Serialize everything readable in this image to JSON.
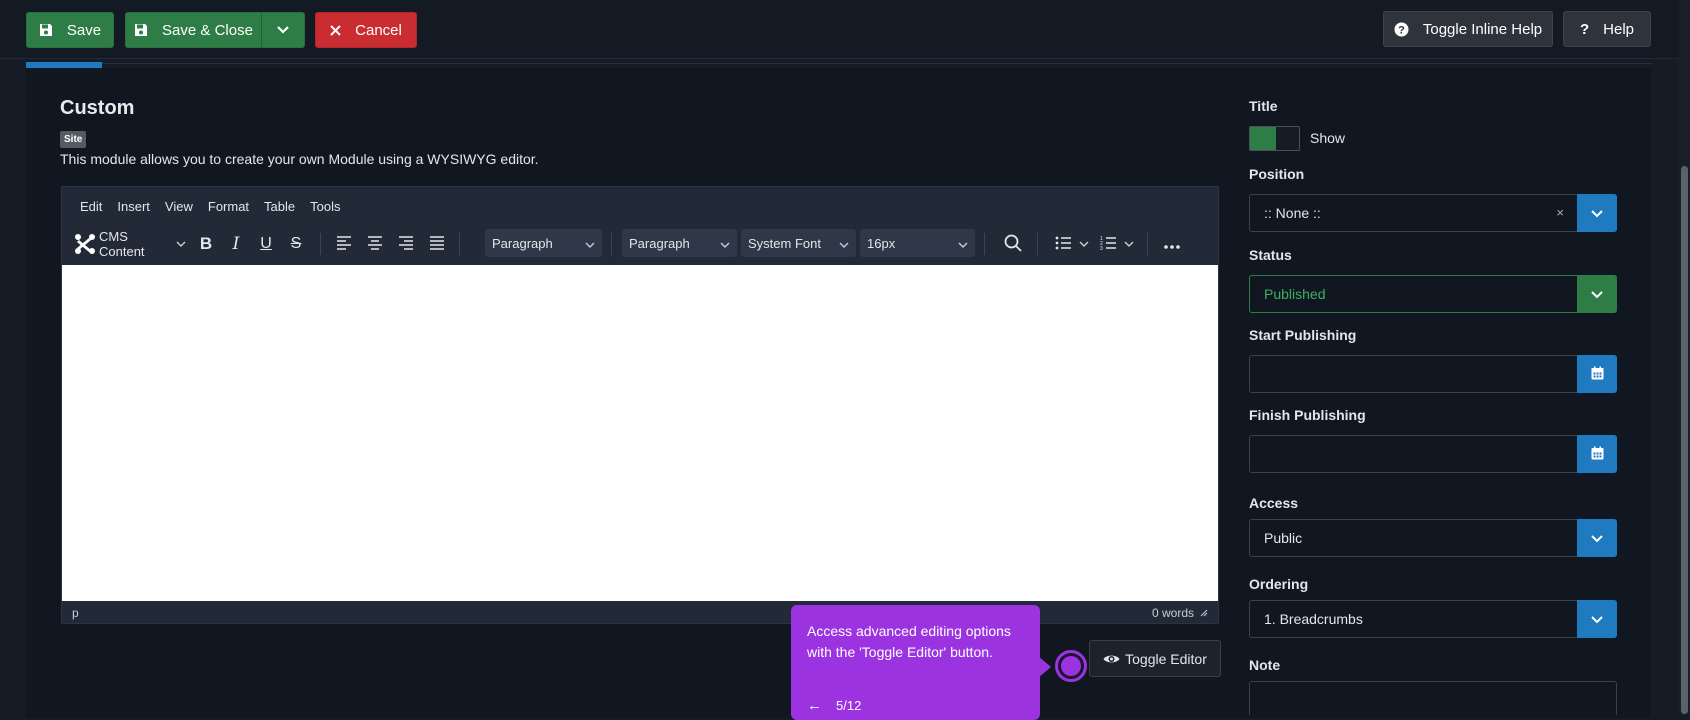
{
  "toolbar": {
    "save_label": "Save",
    "save_close_label": "Save & Close",
    "cancel_label": "Cancel",
    "toggle_inline_help_label": "Toggle Inline Help",
    "help_label": "Help"
  },
  "module": {
    "title": "Custom",
    "badge": "Site",
    "description": "This module allows you to create your own Module using a WYSIWYG editor."
  },
  "editor": {
    "menu": [
      "Edit",
      "Insert",
      "View",
      "Format",
      "Table",
      "Tools"
    ],
    "cms_content_label": "CMS Content",
    "block_format_1": "Paragraph",
    "block_format_2": "Paragraph",
    "font_family": "System Font",
    "font_size": "16px",
    "status_path": "p",
    "word_count": "0 words",
    "toggle_editor_label": "Toggle Editor"
  },
  "tooltip": {
    "text": "Access advanced editing options with the 'Toggle Editor' button.",
    "progress": "5/12"
  },
  "sidebar": {
    "title_label": "Title",
    "title_switch_text": "Show",
    "position_label": "Position",
    "position_value": ":: None ::",
    "status_label": "Status",
    "status_value": "Published",
    "start_publishing_label": "Start Publishing",
    "finish_publishing_label": "Finish Publishing",
    "access_label": "Access",
    "access_value": "Public",
    "ordering_label": "Ordering",
    "ordering_value": "1. Breadcrumbs",
    "note_label": "Note"
  },
  "colors": {
    "accent_blue": "#1f7ac0",
    "success_green": "#2f7d46",
    "danger_red": "#c92d32",
    "tour_purple": "#9b34e0"
  }
}
